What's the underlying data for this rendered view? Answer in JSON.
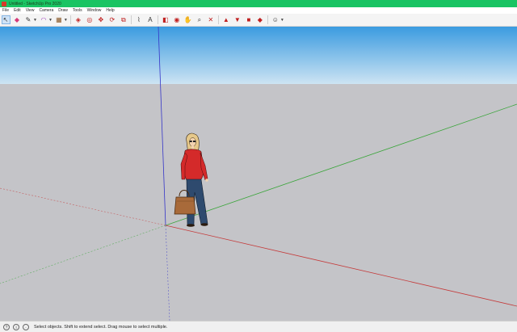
{
  "window": {
    "title": "Untitled - SketchUp Pro 2020"
  },
  "menu": {
    "items": [
      "File",
      "Edit",
      "View",
      "Camera",
      "Draw",
      "Tools",
      "Window",
      "Help"
    ]
  },
  "toolbar": {
    "tools": [
      {
        "name": "select-tool-icon",
        "glyph": "↖",
        "active": true
      },
      {
        "name": "eraser-tool-icon",
        "glyph": "◆",
        "color": "#d63a7a"
      },
      {
        "name": "line-tool-icon",
        "glyph": "✎",
        "dropdown": true
      },
      {
        "name": "arc-tool-icon",
        "glyph": "◠",
        "color": "#a040c0",
        "dropdown": true
      },
      {
        "name": "rectangle-tool-icon",
        "glyph": "▦",
        "color": "#8a5a2a",
        "dropdown": true
      },
      {
        "name": "push-pull-tool-icon",
        "glyph": "◈",
        "color": "#c02020"
      },
      {
        "name": "offset-tool-icon",
        "glyph": "◎",
        "color": "#c02020"
      },
      {
        "name": "move-tool-icon",
        "glyph": "✥",
        "color": "#c02020"
      },
      {
        "name": "rotate-tool-icon",
        "glyph": "⟳",
        "color": "#c02020"
      },
      {
        "name": "scale-tool-icon",
        "glyph": "⧉",
        "color": "#c02020"
      },
      {
        "name": "tape-measure-tool-icon",
        "glyph": "⌇",
        "color": "#444"
      },
      {
        "name": "text-tool-icon",
        "glyph": "A",
        "color": "#333"
      },
      {
        "name": "paint-bucket-tool-icon",
        "glyph": "◧",
        "color": "#c02020"
      },
      {
        "name": "orbit-tool-icon",
        "glyph": "◉",
        "color": "#c02020"
      },
      {
        "name": "pan-tool-icon",
        "glyph": "✋",
        "color": "#c08a2a"
      },
      {
        "name": "zoom-tool-icon",
        "glyph": "⌕",
        "color": "#333"
      },
      {
        "name": "zoom-extents-tool-icon",
        "glyph": "✕",
        "color": "#c02020"
      },
      {
        "name": "warehouse-icon",
        "glyph": "▲",
        "color": "#c02020"
      },
      {
        "name": "extension-warehouse-icon",
        "glyph": "▼",
        "color": "#c02020"
      },
      {
        "name": "extension-manager-icon",
        "glyph": "■",
        "color": "#c02020"
      },
      {
        "name": "ruby-console-icon",
        "glyph": "◆",
        "color": "#c02020"
      },
      {
        "name": "account-icon",
        "glyph": "☺",
        "color": "#333",
        "dropdown": true
      }
    ]
  },
  "viewport": {
    "sky_top": "#3b9be0",
    "sky_bottom": "#cde4f3",
    "ground": "#c4c4c8",
    "axis_red": "#c53a3a",
    "axis_green": "#3aa53a",
    "axis_blue": "#3535c8"
  },
  "statusbar": {
    "text": "Select objects. Shift to extend select. Drag mouse to select multiple."
  }
}
